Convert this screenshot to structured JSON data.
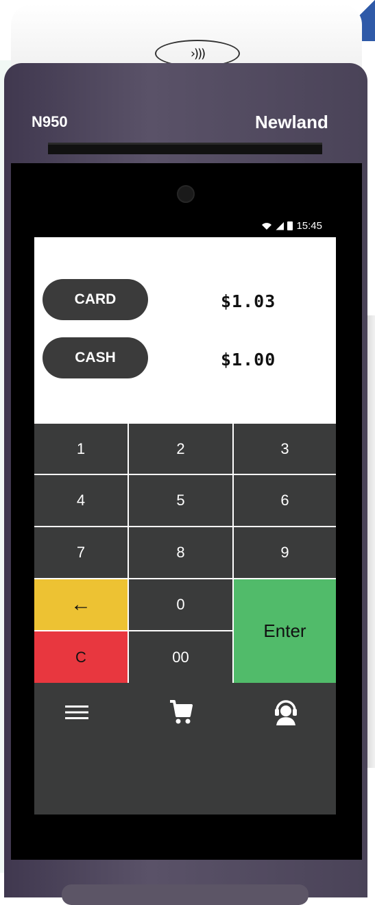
{
  "device": {
    "model": "N950",
    "brand": "Newland",
    "contactless_symbol": "›)))"
  },
  "status_bar": {
    "time": "15:45",
    "icons": [
      "wifi-icon",
      "signal-icon",
      "battery-icon"
    ]
  },
  "payments": [
    {
      "method": "CARD",
      "amount": "$1.03"
    },
    {
      "method": "CASH",
      "amount": "$1.00"
    }
  ],
  "keypad": {
    "k1": "1",
    "k2": "2",
    "k3": "3",
    "k4": "4",
    "k5": "5",
    "k6": "6",
    "k7": "7",
    "k8": "8",
    "k9": "9",
    "backspace": "←",
    "k0": "0",
    "enter": "Enter",
    "clear": "C",
    "k00": "00"
  },
  "nav": {
    "items": [
      "menu-icon",
      "cart-icon",
      "support-agent-icon"
    ]
  },
  "colors": {
    "backspace": "#edc233",
    "clear": "#e8373f",
    "enter": "#51bb6a",
    "key": "#3a3b3b",
    "device_body": "#4f4860"
  }
}
